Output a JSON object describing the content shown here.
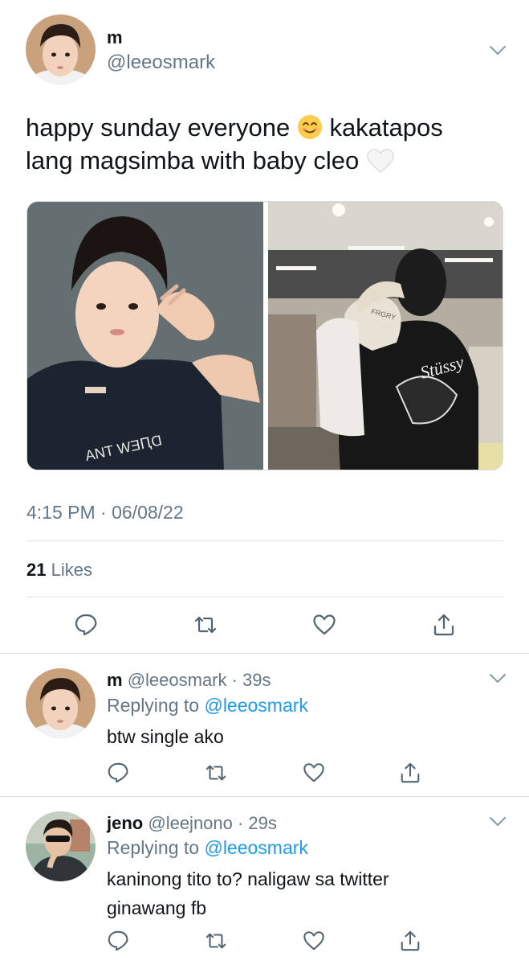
{
  "main_tweet": {
    "name": "m",
    "handle": "@leeosmark",
    "text_line1_before": "happy sunday everyone",
    "text_line1_after": "kakatapos",
    "text_line2": "lang magsimba with baby cleo",
    "photo_left_shirt_text": "ANT WƎԤⱭ",
    "photo_right_cap_text": "FRGRY",
    "photo_right_shirt_text": "Stüssy",
    "timestamp": "4:15 PM · 06/08/22",
    "likes_count": "21",
    "likes_label": "Likes",
    "icons": [
      "reply-icon",
      "retweet-icon",
      "like-icon",
      "share-icon"
    ]
  },
  "replies": [
    {
      "name": "m",
      "handle_time": "@leeosmark · 39s",
      "replying_prefix": "Replying to",
      "replying_handle": "@leeosmark",
      "text": "btw single ako"
    },
    {
      "name": "jeno",
      "handle_time": "@leejnono · 29s",
      "replying_prefix": "Replying to",
      "replying_handle": "@leeosmark",
      "text": "kaninong tito to? naligaw sa twitter ginawang fb"
    }
  ],
  "colors": {
    "accent": "#1d9bf0",
    "muted": "#657786",
    "text": "#0f1419"
  }
}
